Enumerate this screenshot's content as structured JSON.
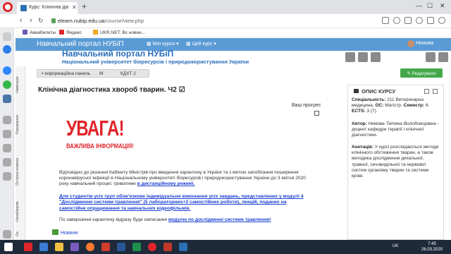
{
  "browser": {
    "tab_title": "Курс: Клінічна діагностика",
    "url_host": "elearn.nubip.edu.ua",
    "url_path": "/course/view.php",
    "bookmarks": [
      "Авиабилеты",
      "Яндекс",
      "UKR.NET: Вс новин..."
    ]
  },
  "moodle": {
    "brand": "Навчальний портал НУБіП",
    "menu_courses": "Мої курси",
    "menu_this_course": "Цей курс",
    "user_name": "Немова",
    "portal_title": "Навчальний портал НУБіП",
    "portal_subtitle": "Національний університет біоресурсів і природокористування України",
    "edit_button": "Редагувати"
  },
  "breadcrumb": [
    "Інформаційна панель",
    "М",
    "КДХТ 2"
  ],
  "left_rail": [
    "Навігація",
    "Керування",
    "Останні новини",
    "Незабаром",
    "Ок"
  ],
  "course": {
    "title": "Клінічна діагностика хвороб тварин. Ч2",
    "title_icon": "☑",
    "progress_label": "Ваш прогрес",
    "alert_main": "УВАГА!",
    "alert_sub": "ВАЖЛИВА ІНФОРМАЦІЯ!",
    "p1_text": "Відповідно до рішення Кабінету Міністрів про введення карантину в Україні та з метою запобігання поширення коронавірусної інфекції в Національному університеті біоресурсів і природокористування України до 3 квітня 2020 року навчальний процес триватиме",
    "p1_link": "в дистанційному режимі.",
    "p2": "Для студентів усіх груп обов'язкове індивідуальне виконання усіх завдань, представлених у модулі 4 \"Дослідження системи травлення\" (5 лабораторних+2 самостійних роботи), лекцій, поданих на самостійне опрацювання та навчальних відеофільмів.",
    "p3_text": "По завершенні карантину відразу буде написання",
    "p3_link": "модулю по дослідженні системи травлення!",
    "news": "Новини"
  },
  "course_info": {
    "heading": "ОПИС КУРСУ",
    "spec_label": "Спеціальність:",
    "spec_value": "211 Ветеринарна медицина.",
    "os_label": "ОС:",
    "os_value": "Магістр.",
    "sem_label": "Семестр:",
    "sem_value": "6.",
    "ects_label": "ECTS:",
    "ects_value": "3 (7).",
    "author_label": "Автор:",
    "author_name": "Немова Тетяна Володимирівна",
    "author_rest": "- доцент кафедри терапії і клінічної діагностики.",
    "annot_label": "Анотація:",
    "annot_text": "У курсі розглядаються методи клінічного обстеження тварин, а також методика дослідження дихальної, травної, сечовидільної та нервової систем організму тварин та системи крові."
  },
  "taskbar": {
    "lang": "UK",
    "time": "7:45",
    "date": "26.03.2020"
  }
}
